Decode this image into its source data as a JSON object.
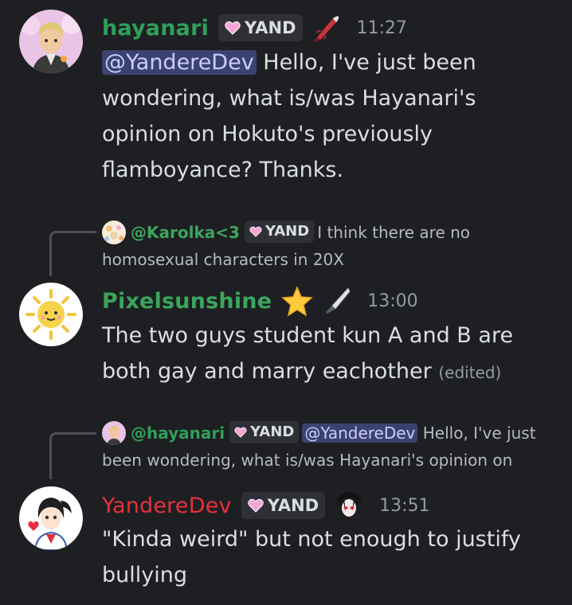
{
  "messages": [
    {
      "username": "hayanari",
      "username_color": "#2f9f5b",
      "tag": "YAND",
      "role_icon": "rocket-icon",
      "time": "11:27",
      "mention": "@YandereDev",
      "text": " Hello, I've just been wondering, what is/was Hayanari's opinion on Hokuto's previously flamboyance? Thanks."
    },
    {
      "reply": {
        "username": "@Karolka<3",
        "username_color": "#3ba55d",
        "tag": "YAND",
        "text": "I think there are no homosexual characters in 20X"
      },
      "username": "Pixelsunshine",
      "username_color": "#3ba55d",
      "emoji": "star-icon",
      "role_icon": "knife-icon",
      "time": "13:00",
      "text": "The two guys student kun A and B are both gay and marry eachother",
      "edited": "(edited)"
    },
    {
      "reply": {
        "username": "@hayanari",
        "username_color": "#2f9f5b",
        "tag": "YAND",
        "mention": "@YandereDev",
        "text": "Hello, I've just been wondering, what is/was Hayanari's opinion on"
      },
      "username": "YandereDev",
      "username_color": "#e8303e",
      "tag": "YAND",
      "role_icon": "anime-face-icon",
      "time": "13:51",
      "text": "\"Kinda weird\" but not enough to justify bullying"
    }
  ],
  "colors": {
    "background": "#1e1f22",
    "text": "#dbdee1",
    "muted": "#949ba4",
    "mention_bg": "#3c4270",
    "mention_text": "#c9cdfb",
    "tag_bg": "#2e3036",
    "heart": "#f4a6d6"
  }
}
